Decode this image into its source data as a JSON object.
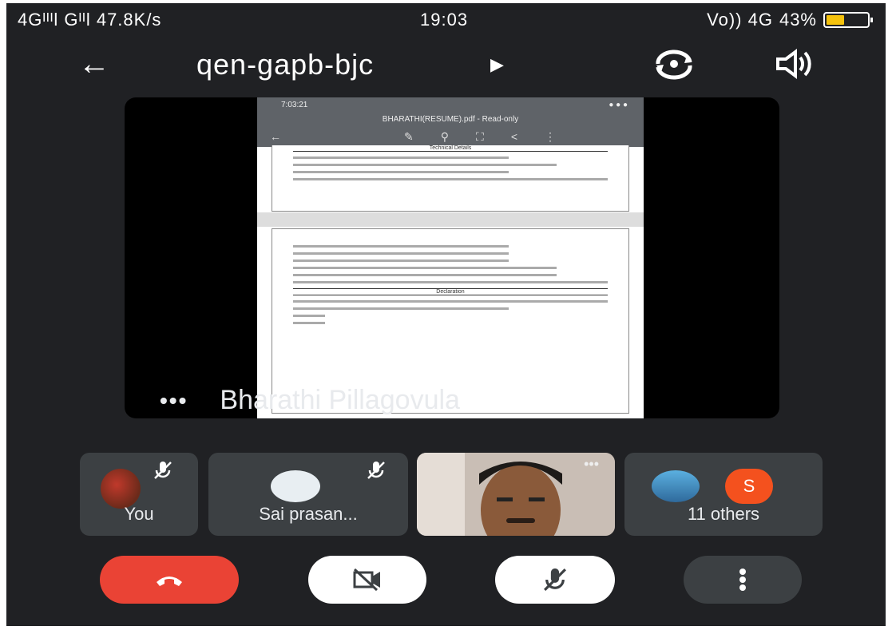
{
  "status_bar": {
    "left": "4Gᴵᴵᴵl Gᴵᴵl 47.8K/s",
    "time": "19:03",
    "network": "Vo)) 4G",
    "battery": "43%",
    "battery_level": 0.43
  },
  "header": {
    "meeting_code": "qen-gapb-bjc"
  },
  "presentation": {
    "doc_status_time": "7:03:21",
    "doc_title": "BHARATHI(RESUME).pdf - Read-only",
    "section_heading_1": "Technical Details",
    "section_heading_2": "Declaration",
    "presenter_name": "Bharathi Pillagovula"
  },
  "participants": {
    "you_label": "You",
    "sai_label": "Sai prasan...",
    "others_label": "11 others",
    "others_badge": "S"
  },
  "colors": {
    "end_call": "#ea4335",
    "badge": "#f4511e",
    "tile": "#3c4043",
    "background": "#202124"
  }
}
